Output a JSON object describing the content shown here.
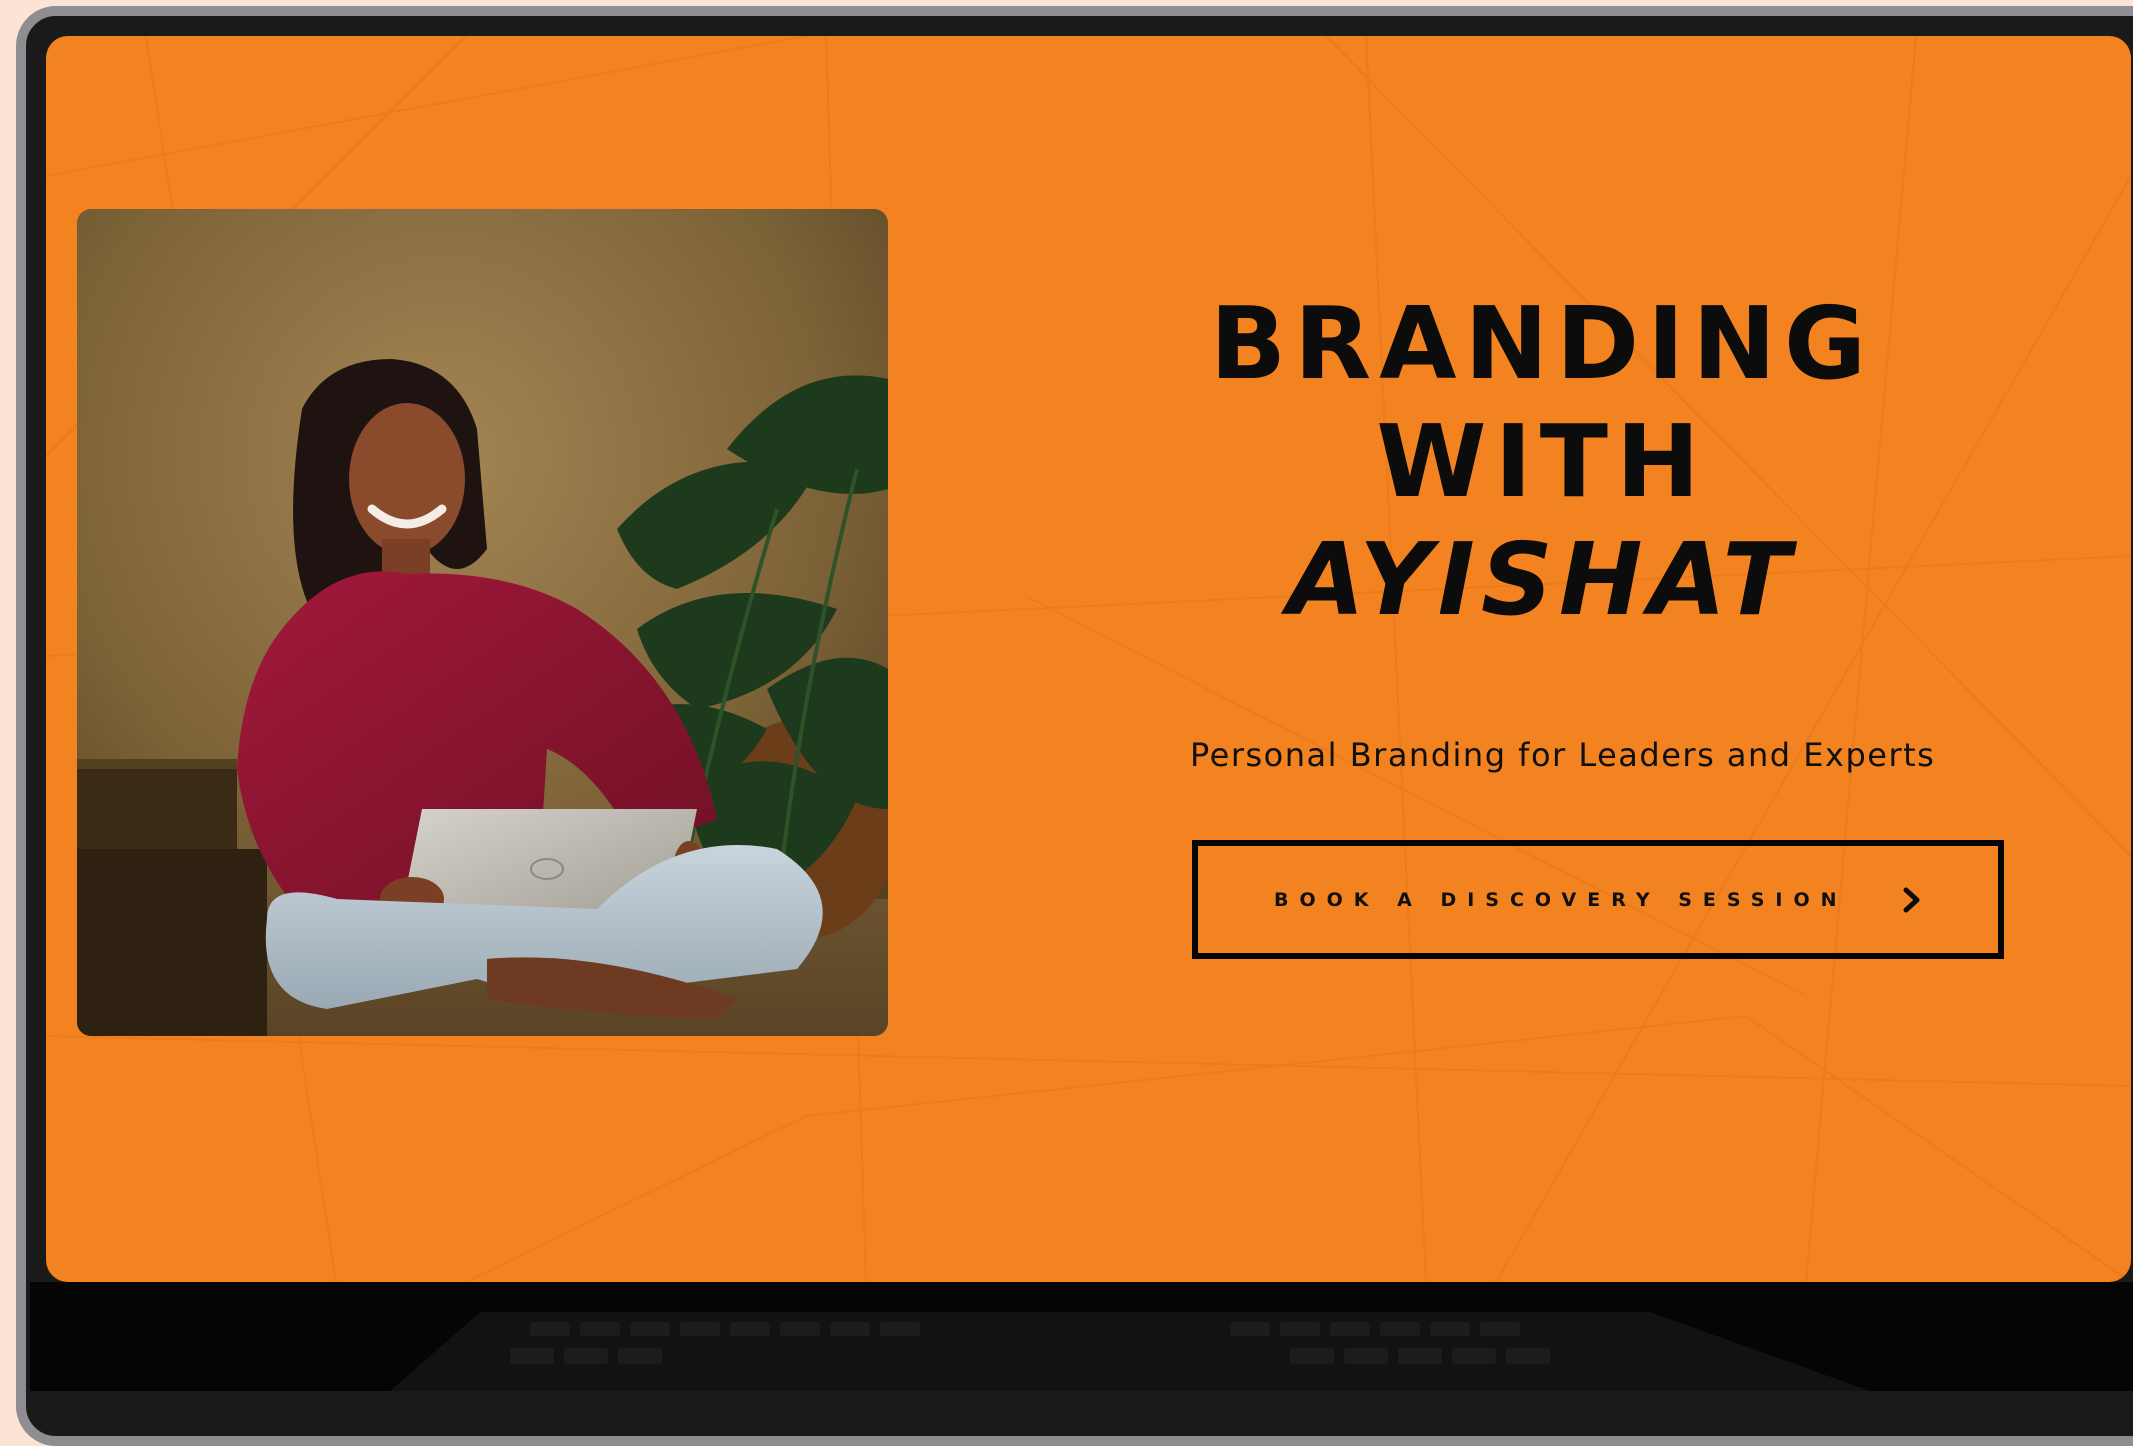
{
  "hero": {
    "title_line1": "BRANDING",
    "title_line2": "WITH",
    "title_line3": "AYISHAT",
    "subtitle": "Personal Branding for Leaders and Experts",
    "photo_alt": "Woman in a maroon top sitting cross-legged holding a laptop beside a monstera plant"
  },
  "cta": {
    "label": "BOOK A DISCOVERY SESSION",
    "icon": "chevron-right-icon"
  },
  "colors": {
    "page_background": "#fbe3d6",
    "screen_background": "#f38220",
    "text": "#0c0c0c",
    "button_border": "#050505",
    "laptop_bezel": "#1a1a1a",
    "laptop_frame": "#8e8e92"
  }
}
